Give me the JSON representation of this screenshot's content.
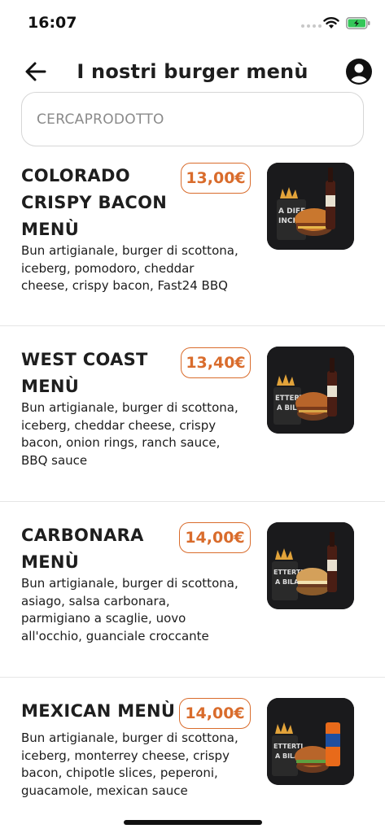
{
  "status_bar": {
    "time": "16:07"
  },
  "header": {
    "title": "I nostri burger menù"
  },
  "search": {
    "placeholder": "CERCAPRODOTTO",
    "value": ""
  },
  "items": [
    {
      "name_lines": [
        "COLORADO",
        "CRISPY BACON",
        "MENÙ"
      ],
      "price": "13,00€",
      "description_lines": [
        "Bun artigianale, burger di scottona,",
        "iceberg, pomodoro, cheddar",
        "cheese, crispy bacon, Fast24 BBQ"
      ],
      "thumb_text": [
        "A DIFF",
        "INCIA"
      ]
    },
    {
      "name_lines": [
        "WEST COAST",
        "MENÙ"
      ],
      "price": "13,40€",
      "description_lines": [
        "Bun artigianale, burger di scottona,",
        "iceberg, cheddar cheese, crispy",
        "bacon, onion rings, ranch sauce,",
        "BBQ sauce"
      ],
      "thumb_text": [
        "ETTERTI",
        "A BILA"
      ]
    },
    {
      "name_lines": [
        "CARBONARA",
        "MENÙ"
      ],
      "price": "14,00€",
      "description_lines": [
        "Bun artigianale, burger di scottona,",
        "asiago, salsa carbonara,",
        "parmigiano a scaglie, uovo",
        "all'occhio, guanciale croccante"
      ],
      "thumb_text": [
        "ETTERTI",
        "A BILA"
      ]
    },
    {
      "name_lines": [
        "MEXICAN MENÙ"
      ],
      "price": "14,00€",
      "description_lines": [
        "Bun artigianale, burger di scottona,",
        "iceberg, monterrey cheese, crispy",
        "bacon, chipotle slices, peperoni,",
        "guacamole, mexican sauce"
      ],
      "thumb_text": [
        "ETTERTI",
        "A BILA"
      ]
    }
  ],
  "colors": {
    "accent": "#d96c2c",
    "text": "#1e1e1e",
    "divider": "#e6e6e6",
    "thumb_bg": "#1a1a1c"
  },
  "icons": {
    "back": "arrow-left-icon",
    "account": "user-circle-icon",
    "wifi": "wifi-icon",
    "battery": "battery-charging-icon",
    "signal": "signal-dots-icon"
  }
}
